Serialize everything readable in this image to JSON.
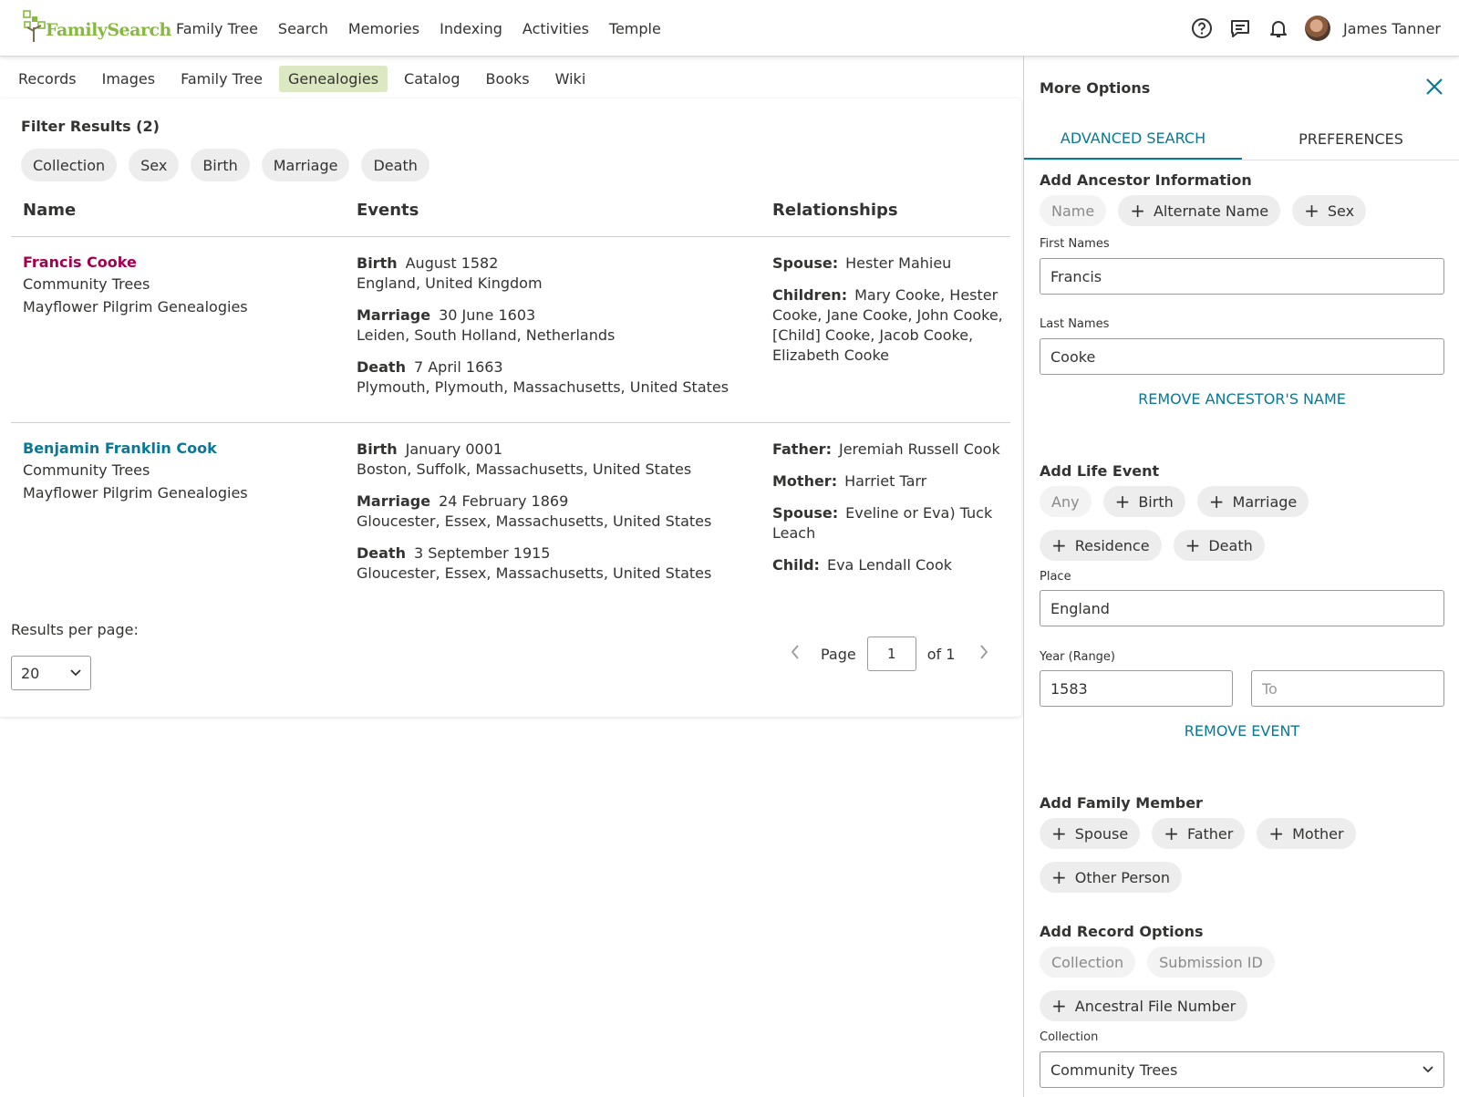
{
  "header": {
    "logo_text": "FamilySearch",
    "nav": [
      "Family Tree",
      "Search",
      "Memories",
      "Indexing",
      "Activities",
      "Temple"
    ],
    "icons": [
      "help-icon",
      "messages-icon",
      "notifications-icon"
    ],
    "user_name": "James Tanner"
  },
  "subnav": {
    "tabs": [
      "Records",
      "Images",
      "Family Tree",
      "Genealogies",
      "Catalog",
      "Books",
      "Wiki"
    ],
    "active": "Genealogies"
  },
  "filters": {
    "title": "Filter Results (2)",
    "chips": [
      "Collection",
      "Sex",
      "Birth",
      "Marriage",
      "Death"
    ]
  },
  "table": {
    "headers": {
      "name": "Name",
      "events": "Events",
      "relationships": "Relationships"
    },
    "rows": [
      {
        "name": "Francis Cooke",
        "name_color": "#a3004e",
        "collection": "Community Trees",
        "source": "Mayflower Pilgrim Genealogies",
        "events": [
          {
            "type": "Birth",
            "date": "August 1582",
            "place": "England, United Kingdom"
          },
          {
            "type": "Marriage",
            "date": "30 June 1603",
            "place": "Leiden, South Holland, Netherlands"
          },
          {
            "type": "Death",
            "date": "7 April 1663",
            "place": "Plymouth, Plymouth, Massachusetts, United States"
          }
        ],
        "relationships": [
          {
            "label": "Spouse:",
            "value": "Hester Mahieu"
          },
          {
            "label": "Children:",
            "value": "Mary Cooke, Hester Cooke, Jane Cooke, John Cooke, [Child] Cooke, Jacob Cooke, Elizabeth Cooke"
          }
        ]
      },
      {
        "name": "Benjamin Franklin Cook",
        "name_color": "#0a7893",
        "collection": "Community Trees",
        "source": "Mayflower Pilgrim Genealogies",
        "events": [
          {
            "type": "Birth",
            "date": "January 0001",
            "place": "Boston, Suffolk, Massachusetts, United States"
          },
          {
            "type": "Marriage",
            "date": "24 February 1869",
            "place": "Gloucester, Essex, Massachusetts, United States"
          },
          {
            "type": "Death",
            "date": "3 September 1915",
            "place": "Gloucester, Essex, Massachusetts, United States"
          }
        ],
        "relationships": [
          {
            "label": "Father:",
            "value": "Jeremiah Russell Cook"
          },
          {
            "label": "Mother:",
            "value": "Harriet Tarr"
          },
          {
            "label": "Spouse:",
            "value": "Eveline or Eva) Tuck Leach"
          },
          {
            "label": "Child:",
            "value": "Eva Lendall Cook"
          }
        ]
      }
    ]
  },
  "pagination": {
    "results_per_page_label": "Results per page:",
    "results_per_page": "20",
    "page_label": "Page",
    "page": "1",
    "of_label": "of 1"
  },
  "panel": {
    "title": "More Options",
    "tabs": [
      "ADVANCED SEARCH",
      "PREFERENCES"
    ],
    "ancestor": {
      "title": "Add Ancestor Information",
      "chips": [
        {
          "label": "Name",
          "disabled": true
        },
        {
          "label": "Alternate Name",
          "disabled": false
        },
        {
          "label": "Sex",
          "disabled": false
        }
      ],
      "first_names_label": "First Names",
      "first_names": "Francis",
      "last_names_label": "Last Names",
      "last_names": "Cooke",
      "remove_link": "REMOVE ANCESTOR'S NAME"
    },
    "life_event": {
      "title": "Add Life Event",
      "chips": [
        {
          "label": "Any",
          "disabled": true
        },
        {
          "label": "Birth",
          "disabled": false
        },
        {
          "label": "Marriage",
          "disabled": false
        },
        {
          "label": "Residence",
          "disabled": false
        },
        {
          "label": "Death",
          "disabled": false
        }
      ],
      "place_label": "Place",
      "place": "England",
      "year_label": "Year (Range)",
      "year_from": "1583",
      "year_to_placeholder": "To",
      "remove_link": "REMOVE EVENT"
    },
    "family": {
      "title": "Add Family Member",
      "chips": [
        "Spouse",
        "Father",
        "Mother",
        "Other Person"
      ]
    },
    "record": {
      "title": "Add Record Options",
      "chips": [
        {
          "label": "Collection",
          "disabled": true
        },
        {
          "label": "Submission ID",
          "disabled": true
        },
        {
          "label": "Ancestral File Number",
          "disabled": false
        }
      ],
      "collection_label": "Collection",
      "collection": "Community Trees"
    }
  },
  "colors": {
    "accent": "#0a7893",
    "brand_green": "#87b940",
    "active_tab_bg": "#dbe8c2"
  }
}
